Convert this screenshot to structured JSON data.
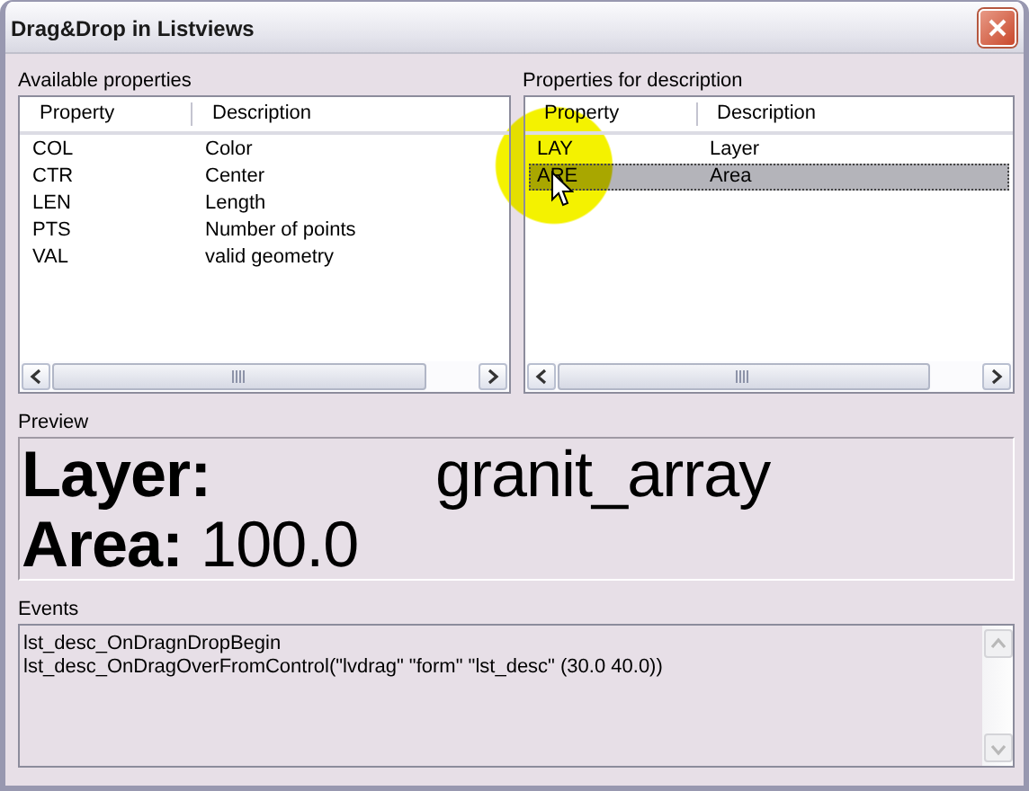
{
  "window": {
    "title": "Drag&Drop in Listviews"
  },
  "lists": [
    {
      "label": "Available properties",
      "columns": [
        "Property",
        "Description"
      ],
      "rows": [
        {
          "cells": [
            "COL",
            "Color"
          ],
          "selected": false
        },
        {
          "cells": [
            "CTR",
            "Center"
          ],
          "selected": false
        },
        {
          "cells": [
            "LEN",
            "Length"
          ],
          "selected": false
        },
        {
          "cells": [
            "PTS",
            "Number of points"
          ],
          "selected": false
        },
        {
          "cells": [
            "VAL",
            "valid geometry"
          ],
          "selected": false
        }
      ]
    },
    {
      "label": "Properties for description",
      "columns": [
        "Property",
        "Description"
      ],
      "rows": [
        {
          "cells": [
            "LAY",
            "Layer"
          ],
          "selected": false
        },
        {
          "cells": [
            "ARE",
            "Area"
          ],
          "selected": true
        }
      ]
    }
  ],
  "preview": {
    "label": "Preview",
    "lines": [
      {
        "label": "Layer:",
        "value": "granit_array",
        "tabbed": true
      },
      {
        "label": "Area:",
        "value": "100.0",
        "tabbed": false
      }
    ]
  },
  "events": {
    "label": "Events",
    "lines": [
      "lst_desc_OnDragnDropBegin",
      "lst_desc_OnDragOverFromControl(\"lvdrag\" \"form\" \"lst_desc\" (30.0 40.0))"
    ]
  }
}
